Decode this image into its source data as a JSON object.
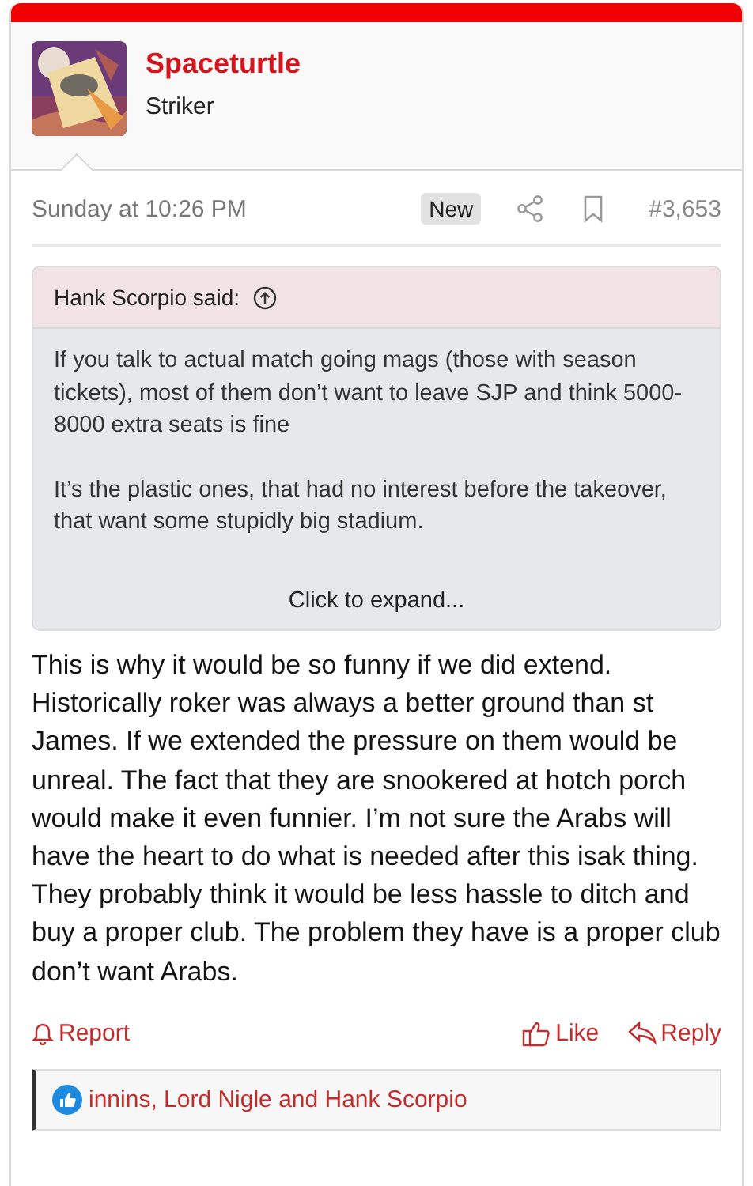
{
  "author": {
    "name": "Spaceturtle",
    "title": "Striker"
  },
  "meta": {
    "date": "Sunday at 10:26 PM",
    "badge": "New",
    "post_number": "#3,653"
  },
  "quote": {
    "attribution": "Hank Scorpio said:",
    "paragraphs": [
      "If you talk to actual match going mags (those with season tickets), most of them don’t want to leave SJP and think 5000-8000 extra seats is fine",
      "It’s the plastic ones, that had no interest before the takeover, that want some stupidly big stadium."
    ],
    "expand": "Click to expand..."
  },
  "body": "This is why it would be so funny if we did extend. Historically roker was always a better ground than st James. If we extended the pressure on them would be unreal. The fact that they are snookered at hotch porch would make it even funnier. I’m not sure the Arabs will have the heart to do what is needed after this isak thing. They probably think it would be less hassle to ditch and buy a proper club. The problem they have is a proper club don’t want Arabs.",
  "actions": [
    {
      "kind": "report",
      "label": "Report"
    },
    {
      "kind": "like",
      "label": "Like"
    },
    {
      "kind": "reply",
      "label": "Reply"
    }
  ],
  "reactions": {
    "text": "innins, Lord Nigle and Hank Scorpio"
  }
}
